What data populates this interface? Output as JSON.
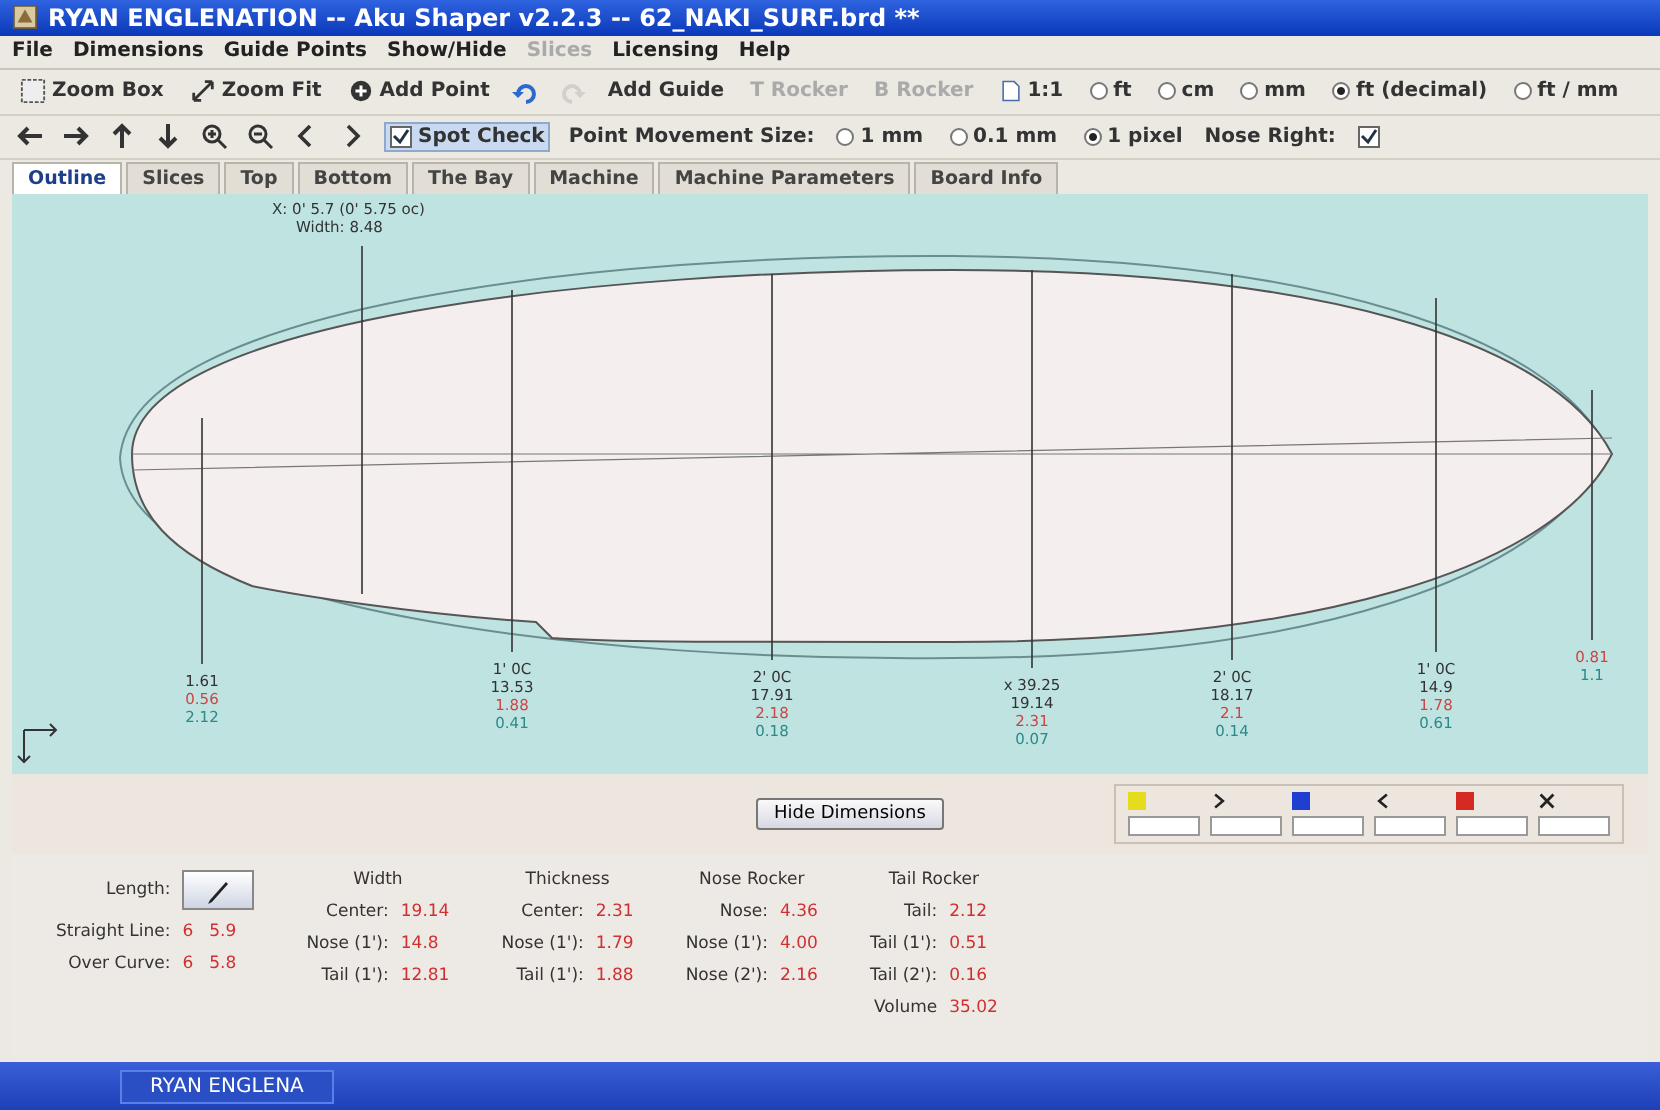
{
  "window": {
    "title": "RYAN ENGLENATION -- Aku Shaper v2.2.3  --  62_NAKI_SURF.brd **"
  },
  "menu": [
    {
      "label": "File",
      "disabled": false
    },
    {
      "label": "Dimensions",
      "disabled": false
    },
    {
      "label": "Guide Points",
      "disabled": false
    },
    {
      "label": "Show/Hide",
      "disabled": false
    },
    {
      "label": "Slices",
      "disabled": true
    },
    {
      "label": "Licensing",
      "disabled": false
    },
    {
      "label": "Help",
      "disabled": false
    }
  ],
  "toolbar": [
    {
      "kind": "button",
      "label": "Zoom Box",
      "disabled": false
    },
    {
      "kind": "button",
      "label": "Zoom Fit",
      "disabled": false
    },
    {
      "kind": "button",
      "label": "Add Point",
      "disabled": false
    },
    {
      "kind": "icon",
      "disabled": false
    },
    {
      "kind": "icon",
      "disabled": true
    },
    {
      "kind": "text",
      "label": "Add Guide",
      "disabled": false
    },
    {
      "kind": "text",
      "label": "T Rocker",
      "disabled": true
    },
    {
      "kind": "text",
      "label": "B Rocker",
      "disabled": true
    },
    {
      "kind": "button",
      "label": "1:1",
      "disabled": false
    },
    {
      "kind": "radio",
      "label": "ft",
      "selected": false
    },
    {
      "kind": "radio",
      "label": "cm",
      "selected": false
    },
    {
      "kind": "radio",
      "label": "mm",
      "selected": false
    },
    {
      "kind": "radio",
      "label": "ft (decimal)",
      "selected": true
    },
    {
      "kind": "radio",
      "label": "ft / mm",
      "selected": false
    }
  ],
  "toolbar_2": [
    {
      "kind": "icon"
    },
    {
      "kind": "icon"
    },
    {
      "kind": "icon"
    },
    {
      "kind": "icon"
    },
    {
      "kind": "icon"
    },
    {
      "kind": "icon"
    },
    {
      "kind": "icon"
    },
    {
      "kind": "icon"
    },
    {
      "kind": "checkbox",
      "label": "Spot Check",
      "checked": true
    },
    {
      "kind": "label",
      "label": "Point Movement Size:"
    },
    {
      "kind": "radio",
      "label": "1 mm",
      "selected": false
    },
    {
      "kind": "radio",
      "label": "0.1 mm",
      "selected": false
    },
    {
      "kind": "radio",
      "label": "1 pixel",
      "selected": true
    },
    {
      "kind": "label",
      "label": "Nose Right:"
    },
    {
      "kind": "checkbox",
      "checked": true
    }
  ],
  "tabs": [
    {
      "label": "Outline",
      "selected": true
    },
    {
      "label": "Slices",
      "selected": false
    },
    {
      "label": "Top",
      "selected": false
    },
    {
      "label": "Bottom",
      "selected": false
    },
    {
      "label": "The Bay",
      "selected": false
    },
    {
      "label": "Machine",
      "selected": false
    },
    {
      "label": "Machine Parameters",
      "selected": false
    },
    {
      "label": "Board Info",
      "selected": false
    }
  ],
  "outline": {
    "spot_check": [
      "X: 0' 5.7 (0' 5.75 oc)",
      "Width: 8.48"
    ],
    "stations": [
      {
        "values": [
          "1.61",
          "0.56",
          "2.12"
        ]
      },
      {
        "values": [
          "1' 0C",
          "13.53",
          "1.88",
          "0.41"
        ]
      },
      {
        "values": [
          "2' 0C",
          "17.91",
          "2.18",
          "0.18"
        ]
      },
      {
        "values": [
          "x 39.25",
          "19.14",
          "2.31",
          "0.07"
        ]
      },
      {
        "values": [
          "2' 0C",
          "18.17",
          "2.1",
          "0.14"
        ]
      },
      {
        "values": [
          "1' 0C",
          "14.9",
          "1.78",
          "0.61"
        ]
      },
      {
        "values": [
          "0.81",
          "1.1"
        ]
      }
    ]
  },
  "hide_dimensions_button": "Hide Dimensions",
  "legend": [
    {
      "color": "#e6dc1e"
    },
    {
      "color": "#1f3fd0"
    },
    {
      "color": "#d42a22"
    }
  ],
  "dimensions": {
    "length_label": "Length:",
    "lines": [
      {
        "label": "Straight Line:",
        "values": [
          "6",
          "5.9"
        ]
      },
      {
        "label": "Over Curve:",
        "values": [
          "6",
          "5.8"
        ]
      }
    ],
    "groups": [
      {
        "title": "Width",
        "fields": [
          {
            "label": "Center:",
            "value": "19.14"
          },
          {
            "label": "Nose (1'):",
            "value": "14.8"
          },
          {
            "label": "Tail (1'):",
            "value": "12.81"
          }
        ]
      },
      {
        "title": "Thickness",
        "fields": [
          {
            "label": "Center:",
            "value": "2.31"
          },
          {
            "label": "Nose (1'):",
            "value": "1.79"
          },
          {
            "label": "Tail (1'):",
            "value": "1.88"
          }
        ]
      },
      {
        "title": "Nose Rocker",
        "fields": [
          {
            "label": "Nose:",
            "value": "4.36"
          },
          {
            "label": "Nose (1'):",
            "value": "4.00"
          },
          {
            "label": "Nose (2'):",
            "value": "2.16"
          }
        ]
      },
      {
        "title": "Tail Rocker",
        "fields": [
          {
            "label": "Tail:",
            "value": "2.12"
          },
          {
            "label": "Tail (1'):",
            "value": "0.51"
          },
          {
            "label": "Tail (2'):",
            "value": "0.16"
          }
        ]
      }
    ],
    "volume": {
      "label": "Volume",
      "value": "35.02"
    }
  },
  "taskbar": {
    "item": "RYAN ENGLENA"
  }
}
